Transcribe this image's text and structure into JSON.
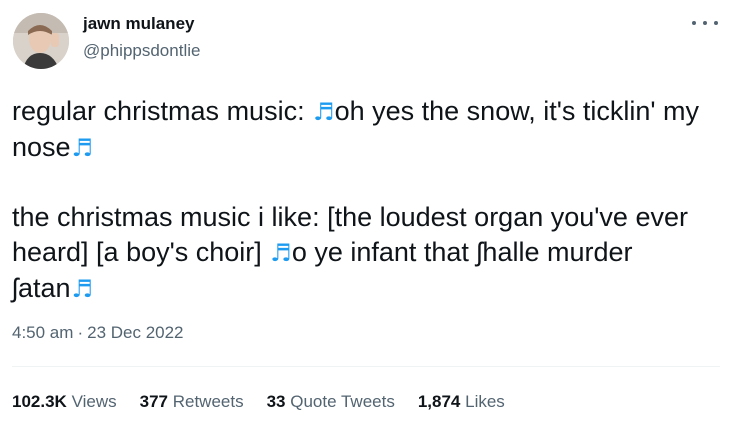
{
  "tweet": {
    "author": {
      "name": "jawn mulaney",
      "handle": "@phippsdontlie"
    },
    "text": {
      "line1_a": "regular christmas music: ",
      "line1_b": "oh yes the snow, it's ticklin' my nose",
      "line2_a": "the christmas music i like: [the loudest organ you've ever heard] [a boy's choir] ",
      "line2_b": "o ye infant that ʃhalle murder ʃatan",
      "note_glyph": "♬"
    },
    "meta": {
      "time": "4:50 am",
      "separator": "·",
      "date": "23 Dec 2022"
    },
    "stats": [
      {
        "count": "102.3K",
        "label": "Views"
      },
      {
        "count": "377",
        "label": "Retweets"
      },
      {
        "count": "33",
        "label": "Quote Tweets"
      },
      {
        "count": "1,874",
        "label": "Likes"
      }
    ],
    "colors": {
      "accent": "#1d9bf0",
      "text": "#0f1419",
      "secondary": "#536471"
    },
    "icons": {
      "more": "more-options-icon",
      "note": "musical-notes-icon"
    }
  }
}
